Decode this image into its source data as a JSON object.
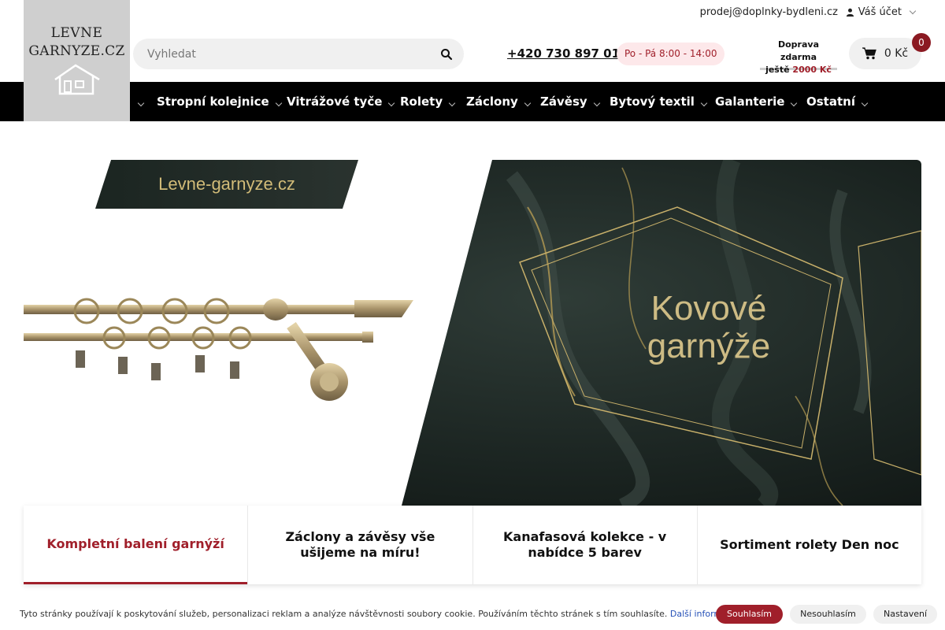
{
  "header": {
    "email": "prodej@doplnky-bydleni.cz",
    "account_label": "Váš účet",
    "logo": {
      "line1": "LEVNE",
      "line2": "GARNYZE.CZ"
    },
    "search": {
      "placeholder": "Vyhledat"
    },
    "phone": "+420 730 897 017",
    "hours": "Po - Pá 8:00 - 14:00",
    "shipping": {
      "line1": "Doprava zdarma",
      "line2_prefix": "ještě",
      "amount": "2000 Kč"
    },
    "cart": {
      "total": "0 Kč",
      "count": "0"
    }
  },
  "nav": {
    "items": [
      {
        "label": "Stropní kolejnice"
      },
      {
        "label": "Vitrážové tyče"
      },
      {
        "label": "Rolety"
      },
      {
        "label": "Záclony"
      },
      {
        "label": "Závěsy"
      },
      {
        "label": "Bytový textil"
      },
      {
        "label": "Galanterie"
      },
      {
        "label": "Ostatní"
      }
    ]
  },
  "banner": {
    "brand": "Levne-garnyze.cz",
    "headline_line1": "Kovové",
    "headline_line2": "garnýže"
  },
  "tabs": [
    {
      "label": "Kompletní balení garnýží",
      "active": true
    },
    {
      "label": "Záclony a závěsy vše ušijeme na míru!"
    },
    {
      "label": "Kanafasová kolekce - v nabídce 5 barev"
    },
    {
      "label": "Sortiment rolety Den noc"
    }
  ],
  "cookie": {
    "text": "Tyto stránky používají k poskytování služeb, personalizaci reklam a analýze návštěvnosti soubory cookie. Používáním těchto stránek s tím souhlasíte.",
    "more_link": "Další informace",
    "accept": "Souhlasím",
    "reject": "Nesouhlasím",
    "settings": "Nastavení"
  },
  "colors": {
    "accent": "#a01f2a",
    "nav_bg": "#000000",
    "logo_bg": "#cfcfcf"
  },
  "icons": [
    "user-icon",
    "search-icon",
    "cart-icon",
    "chevron-down-icon",
    "house-icon"
  ]
}
